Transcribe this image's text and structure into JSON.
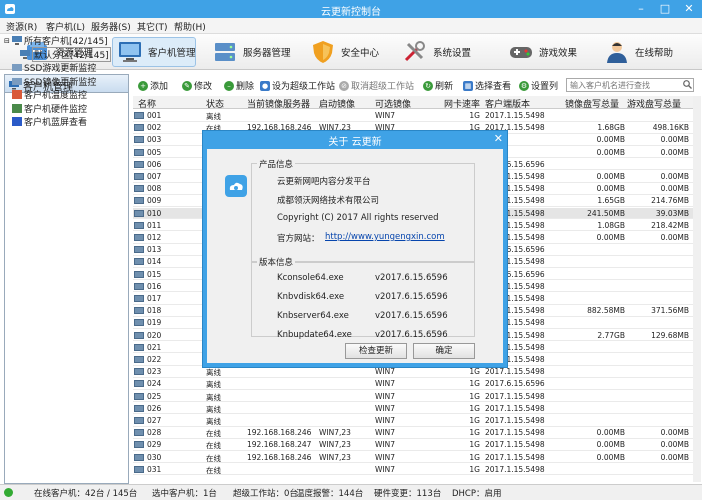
{
  "window": {
    "title": "云更新控制台"
  },
  "menu": [
    "资源(R)",
    "客户机(L)",
    "服务器(S)",
    "其它(T)",
    "帮助(H)"
  ],
  "main_buttons": [
    {
      "label": "资源管理",
      "icon": "resource-icon"
    },
    {
      "label": "客户机管理",
      "icon": "monitor-icon"
    },
    {
      "label": "服务器管理",
      "icon": "server-icon"
    },
    {
      "label": "安全中心",
      "icon": "shield-icon"
    },
    {
      "label": "系统设置",
      "icon": "tools-icon"
    },
    {
      "label": "游戏效果",
      "icon": "gamepad-icon"
    },
    {
      "label": "在线帮助",
      "icon": "person-icon"
    }
  ],
  "left": {
    "title": "客户机管理",
    "tree": [
      "所有客户机[42/145]",
      "默认分区[42/145]",
      "SSD游戏更新监控",
      "SSD镜像更新监控",
      "客户机温度监控",
      "客户机硬件监控",
      "客户机蓝屏查看"
    ]
  },
  "toolbar": [
    "添加",
    "修改",
    "删除",
    "设为超级工作站",
    "取消超级工作站",
    "刷新",
    "选择查看",
    "设置列"
  ],
  "search": {
    "placeholder": "输入客户机名进行查找"
  },
  "columns": [
    "名称",
    "状态",
    "当前镜像服务器",
    "启动镜像",
    "可选镜像",
    "网卡速率",
    "客户端版本",
    "镜像盘写总量",
    "游戏盘写总量"
  ],
  "rows": [
    [
      "001",
      "离线",
      "",
      "",
      "WIN7",
      "1G",
      "2017.1.15.5498",
      "",
      ""
    ],
    [
      "002",
      "在线",
      "192.168.168.246",
      "WIN7,23",
      "WIN7",
      "1G",
      "2017.1.15.5498",
      "1.68GB",
      "498.16KB"
    ],
    [
      "003",
      "在线",
      "",
      "",
      "",
      "",
      "",
      "0.00MB",
      "0.00MB"
    ],
    [
      "005",
      "",
      "",
      "",
      "",
      "",
      "",
      "0.00MB",
      "0.00MB"
    ],
    [
      "006",
      "",
      "",
      "",
      "",
      "",
      "2017.6.15.6596",
      "",
      ""
    ],
    [
      "007",
      "",
      "",
      "",
      "",
      "",
      "2017.1.15.5498",
      "0.00MB",
      "0.00MB"
    ],
    [
      "008",
      "",
      "",
      "",
      "",
      "",
      "2017.1.15.5498",
      "0.00MB",
      "0.00MB"
    ],
    [
      "009",
      "",
      "",
      "",
      "",
      "",
      "2017.1.15.5498",
      "1.65GB",
      "214.76MB"
    ],
    [
      "010",
      "",
      "",
      "",
      "",
      "",
      "2017.1.15.5498",
      "241.50MB",
      "39.03MB"
    ],
    [
      "011",
      "",
      "",
      "",
      "",
      "",
      "2017.1.15.5498",
      "1.08GB",
      "218.42MB"
    ],
    [
      "012",
      "",
      "",
      "",
      "",
      "",
      "2017.1.15.5498",
      "0.00MB",
      "0.00MB"
    ],
    [
      "013",
      "",
      "",
      "",
      "",
      "",
      "2017.6.15.6596",
      "",
      ""
    ],
    [
      "014",
      "",
      "",
      "",
      "",
      "",
      "2017.1.15.5498",
      "",
      ""
    ],
    [
      "015",
      "",
      "",
      "",
      "",
      "",
      "2017.6.15.6596",
      "",
      ""
    ],
    [
      "016",
      "",
      "",
      "",
      "",
      "",
      "2017.1.15.5498",
      "",
      ""
    ],
    [
      "017",
      "",
      "",
      "",
      "",
      "",
      "2017.1.15.5498",
      "",
      ""
    ],
    [
      "018",
      "",
      "",
      "",
      "",
      "",
      "2017.1.15.5498",
      "882.58MB",
      "371.56MB"
    ],
    [
      "019",
      "",
      "",
      "",
      "",
      "",
      "2017.1.15.5498",
      "",
      ""
    ],
    [
      "020",
      "",
      "",
      "",
      "",
      "",
      "2017.1.15.5498",
      "2.77GB",
      "129.68MB"
    ],
    [
      "021",
      "",
      "",
      "",
      "",
      "",
      "2017.1.15.5498",
      "",
      ""
    ],
    [
      "022",
      "",
      "",
      "",
      "",
      "",
      "2017.1.15.5498",
      "",
      ""
    ],
    [
      "023",
      "离线",
      "",
      "",
      "WIN7",
      "1G",
      "2017.1.15.5498",
      "",
      ""
    ],
    [
      "024",
      "离线",
      "",
      "",
      "WIN7",
      "1G",
      "2017.6.15.6596",
      "",
      ""
    ],
    [
      "025",
      "离线",
      "",
      "",
      "WIN7",
      "1G",
      "2017.1.15.5498",
      "",
      ""
    ],
    [
      "026",
      "离线",
      "",
      "",
      "WIN7",
      "1G",
      "2017.1.15.5498",
      "",
      ""
    ],
    [
      "027",
      "离线",
      "",
      "",
      "WIN7",
      "1G",
      "2017.1.15.5498",
      "",
      ""
    ],
    [
      "028",
      "在线",
      "192.168.168.246",
      "WIN7,23",
      "WIN7",
      "1G",
      "2017.1.15.5498",
      "0.00MB",
      "0.00MB"
    ],
    [
      "029",
      "在线",
      "192.168.168.247",
      "WIN7,23",
      "WIN7",
      "1G",
      "2017.1.15.5498",
      "0.00MB",
      "0.00MB"
    ],
    [
      "030",
      "在线",
      "192.168.168.246",
      "WIN7,23",
      "WIN7",
      "1G",
      "2017.1.15.5498",
      "0.00MB",
      "0.00MB"
    ],
    [
      "031",
      "在线",
      "",
      "",
      "WIN7",
      "1G",
      "2017.1.15.5498",
      "",
      ""
    ]
  ],
  "status": [
    "在线客户机：42台 / 145台",
    "选中客户机：1台",
    "超级工作站：0台",
    "温度报警：144台",
    "硬件变更：113台",
    "DHCP：启用"
  ],
  "dialog": {
    "title": "关于 云更新",
    "product_group": "产品信息",
    "product_lines": [
      "云更新网吧内容分发平台",
      "成都领沃网络技术有限公司",
      "Copyright (C) 2017 All rights reserved"
    ],
    "website_label": "官方网站：",
    "website": "http://www.yungengxin.com",
    "version_group": "版本信息",
    "versions": [
      [
        "Kconsole64.exe",
        "v2017.6.15.6596"
      ],
      [
        "Knbvdisk64.exe",
        "v2017.6.15.6596"
      ],
      [
        "Knbserver64.exe",
        "v2017.6.15.6596"
      ],
      [
        "Knbupdate64.exe",
        "v2017.6.15.6596"
      ]
    ],
    "check_update": "检查更新",
    "ok": "确定"
  }
}
